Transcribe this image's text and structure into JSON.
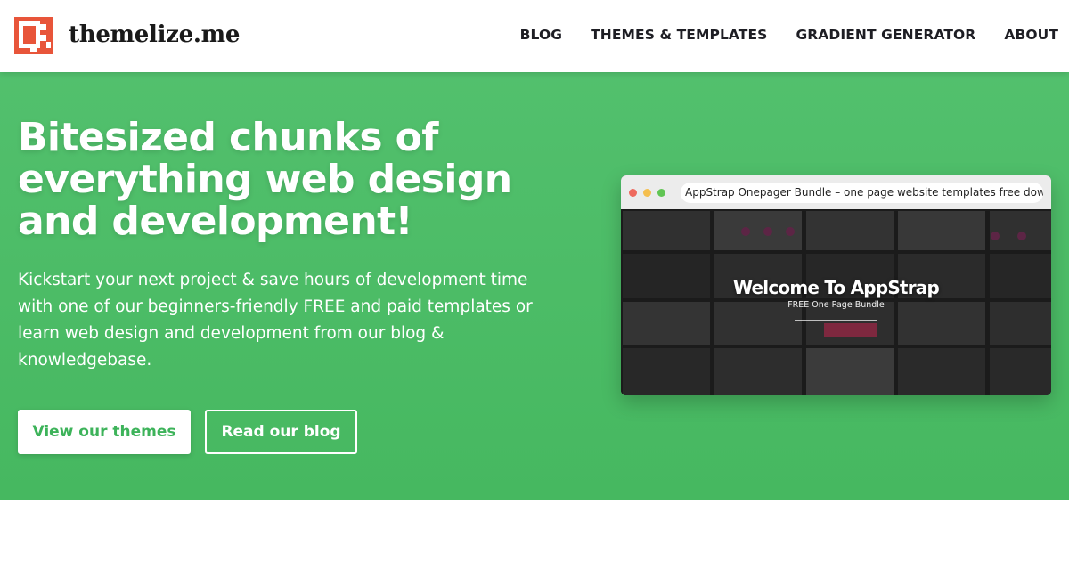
{
  "header": {
    "brand": "themelize.me",
    "nav": [
      "BLOG",
      "THEMES & TEMPLATES",
      "GRADIENT GENERATOR",
      "ABOUT"
    ]
  },
  "hero": {
    "headline": "Bitesized chunks of everything web design and development!",
    "subtext": "Kickstart your next project & save hours of development time with one of our beginners-friendly FREE and paid templates or learn web design and development from our blog & knowledgebase.",
    "primary_button": "View our themes",
    "secondary_button": "Read our blog"
  },
  "preview": {
    "url": "AppStrap Onepager Bundle – one page website templates free download",
    "title": "Welcome To AppStrap",
    "subtitle": "FREE One Page Bundle"
  },
  "colors": {
    "hero_green": "#4dbd67",
    "button_text_green": "#3db35a",
    "logo_orange": "#e8553a"
  }
}
